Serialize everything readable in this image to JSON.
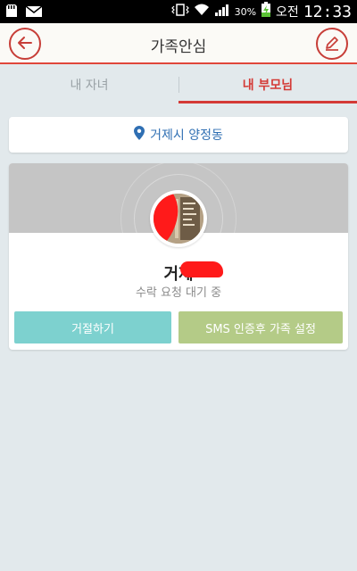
{
  "status_bar": {
    "battery_percent": "30%",
    "ampm": "오전",
    "time": "12:33",
    "icons": [
      "sd-card-icon",
      "mail-icon",
      "vibrate-icon",
      "wifi-icon",
      "signal-icon",
      "battery-charging-icon"
    ]
  },
  "header": {
    "title": "가족안심",
    "back_icon": "back-arrow-icon",
    "edit_icon": "pencil-icon",
    "accent_color": "#c73e38"
  },
  "tabs": [
    {
      "label": "내 자녀",
      "active": false
    },
    {
      "label": "내 부모님",
      "active": true
    }
  ],
  "location": {
    "icon": "map-pin-icon",
    "text": "거제시 양정동"
  },
  "member_card": {
    "name": "거제",
    "status": "수락 요청 대기 중",
    "decline_label": "거절하기",
    "sms_label": "SMS 인증후 가족 설정",
    "decline_color": "#7dd1cf",
    "sms_color": "#b4cb87"
  }
}
